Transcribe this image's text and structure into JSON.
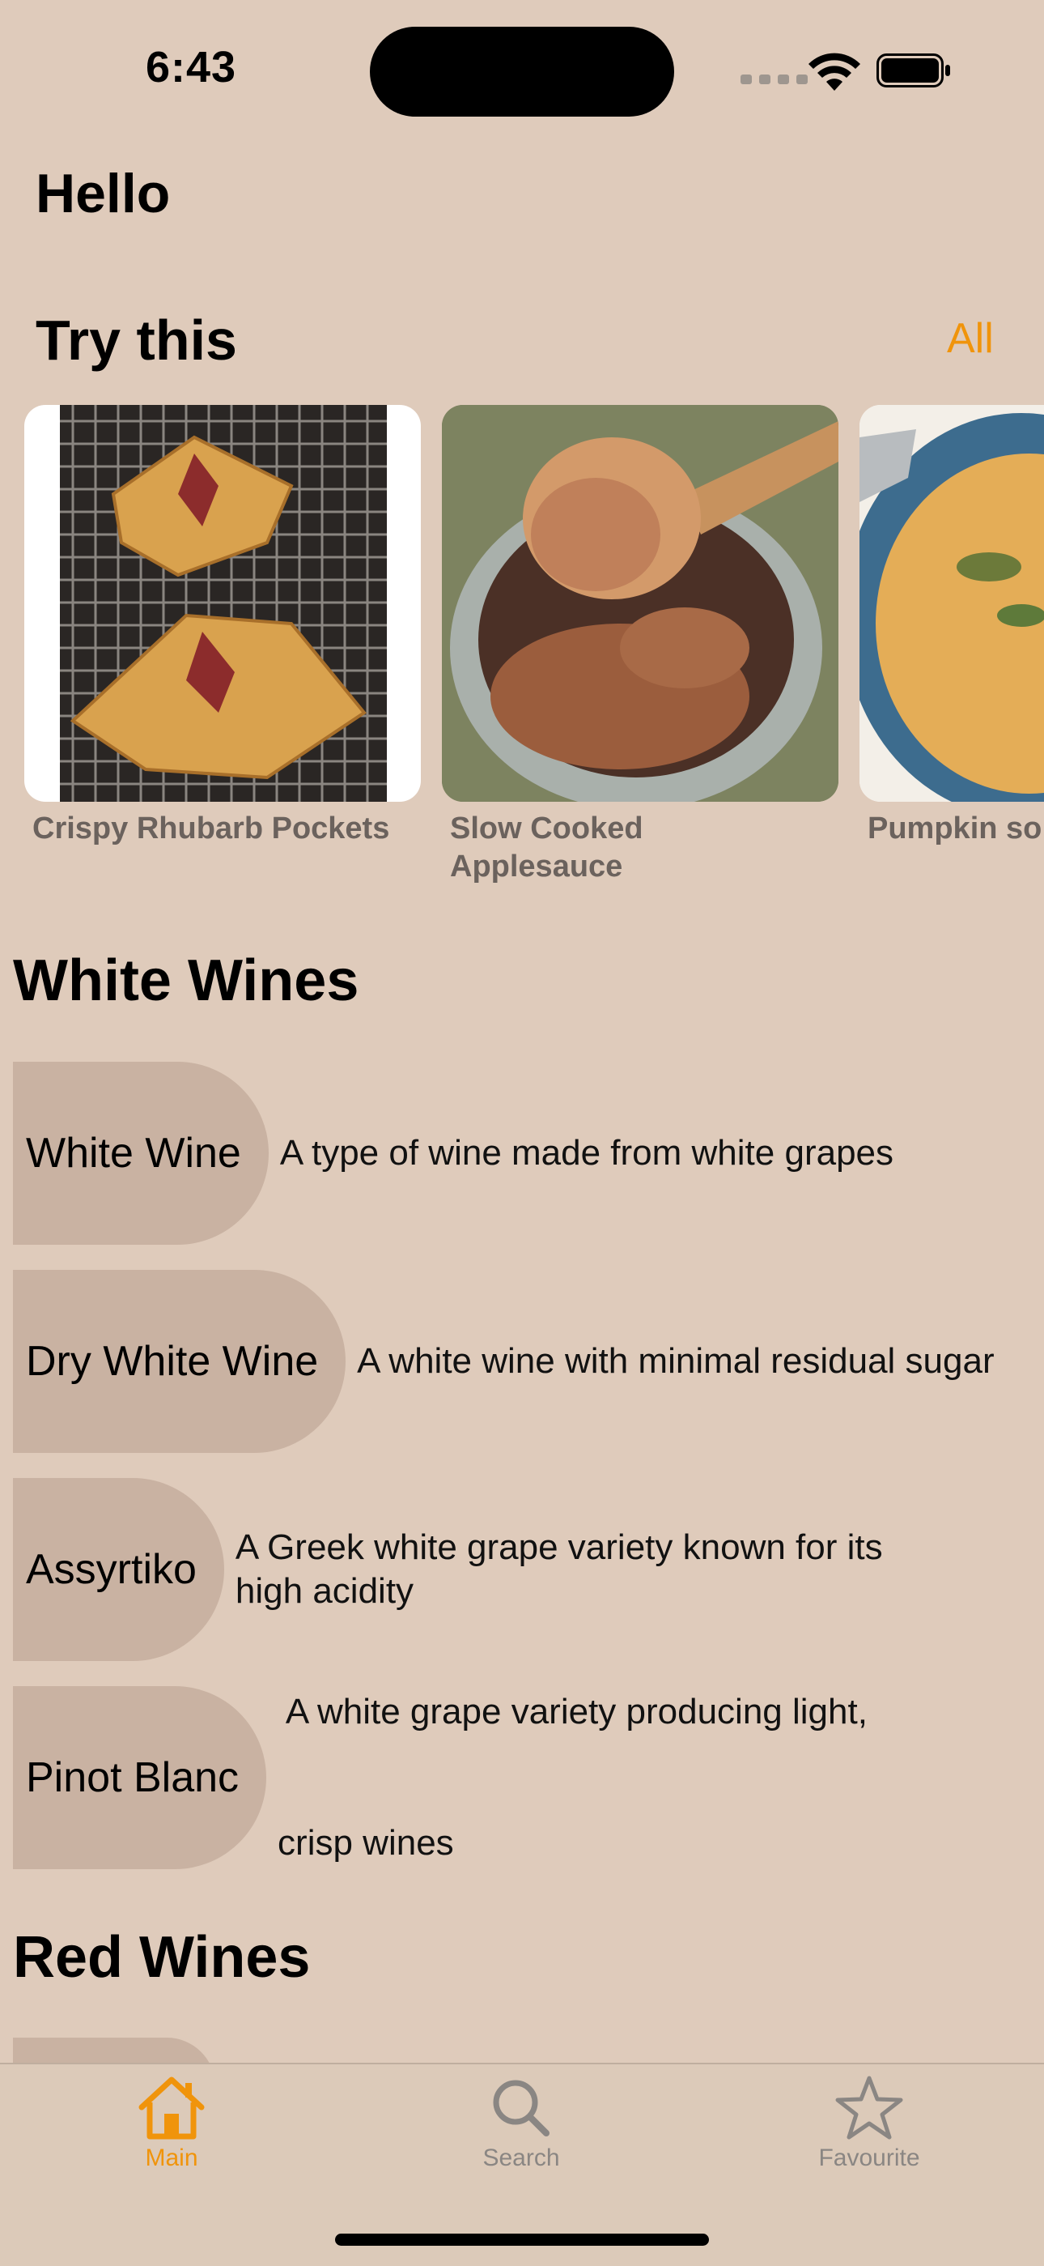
{
  "status_bar": {
    "time": "6:43"
  },
  "header": {
    "greeting": "Hello"
  },
  "try_this": {
    "title": "Try this",
    "all_label": "All",
    "cards": [
      {
        "title": "Crispy Rhubarb Pockets"
      },
      {
        "title_line1": "Slow Cooked",
        "title_line2": "Applesauce"
      },
      {
        "title": "Pumpkin so"
      }
    ]
  },
  "white_wines": {
    "title": "White Wines",
    "items": [
      {
        "name": "White Wine",
        "description": "A type of wine made from white grapes"
      },
      {
        "name": "Dry White Wine",
        "description": "A white wine with minimal residual sugar"
      },
      {
        "name": "Assyrtiko",
        "description_line1": "A Greek white grape variety known for its",
        "description_line2": "high acidity"
      },
      {
        "name": "Pinot Blanc",
        "description_line1": " A white grape variety producing light,",
        "description_line2": "crisp wines"
      }
    ]
  },
  "red_wines": {
    "title": "Red Wines"
  },
  "tab_bar": {
    "tabs": [
      {
        "label": "Main",
        "icon": "house-icon",
        "active": true
      },
      {
        "label": "Search",
        "icon": "magnifier-icon",
        "active": false
      },
      {
        "label": "Favourite",
        "icon": "star-icon",
        "active": false
      }
    ]
  },
  "colors": {
    "accent": "#f0940b",
    "background": "#dfcbbb",
    "pill": "#c9b2a2",
    "inactive": "#8a8683"
  }
}
